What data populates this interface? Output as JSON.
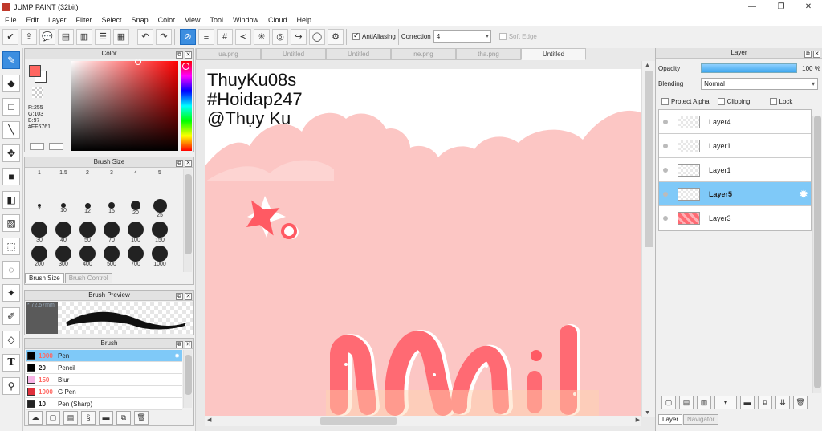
{
  "window": {
    "title": "JUMP PAINT (32bit)",
    "minimize": "—",
    "restore": "❐",
    "close": "✕"
  },
  "menu": [
    "File",
    "Edit",
    "Layer",
    "Filter",
    "Select",
    "Snap",
    "Color",
    "View",
    "Tool",
    "Window",
    "Cloud",
    "Help"
  ],
  "toolbar": {
    "antialiasing_label": "AntiAliasing",
    "antialiasing_checked": true,
    "correction_label": "Correction",
    "correction_value": "4",
    "soft_edge_label": "Soft Edge",
    "soft_edge_checked": false
  },
  "color_panel": {
    "title": "Color",
    "foreground": "#FF6761",
    "rgb": {
      "r": "R:255",
      "g": "G:103",
      "b": "B:97",
      "hex": "#FF6761"
    }
  },
  "brush_size_panel": {
    "title": "Brush Size",
    "sizes": [
      "1",
      "1.5",
      "2",
      "3",
      "4",
      "5",
      "7",
      "10",
      "12",
      "15",
      "20",
      "25",
      "30",
      "40",
      "50",
      "70",
      "100",
      "150",
      "200",
      "300",
      "400",
      "500",
      "700",
      "1000"
    ],
    "tabs": [
      "Brush Size",
      "Brush Control"
    ]
  },
  "brush_preview_panel": {
    "title": "Brush Preview",
    "size_text": "* 72.57mm"
  },
  "brush_panel": {
    "title": "Brush",
    "brushes": [
      {
        "size": "1000",
        "name": "Pen",
        "color": "#000000",
        "selected": true
      },
      {
        "size": "20",
        "name": "Pencil",
        "color": "#000000",
        "selected": false
      },
      {
        "size": "150",
        "name": "Blur",
        "color": "#f7b3e5",
        "selected": false
      },
      {
        "size": "1000",
        "name": "G Pen",
        "color": "#e0303c",
        "selected": false
      },
      {
        "size": "10",
        "name": "Pen (Sharp)",
        "color": "#222222",
        "selected": false
      }
    ]
  },
  "document_tabs": [
    "ua.png",
    "Untitled",
    "Untitled",
    "ne.png",
    "tha.png",
    "Untitled"
  ],
  "active_tab_index": 5,
  "canvas": {
    "text_lines": [
      "ThuyKu08s",
      "#Hoidap247",
      "@Thụy Ku"
    ],
    "bg_color": "#fcc6c4",
    "letter_color": "#ff6a73"
  },
  "layer_panel": {
    "title": "Layer",
    "opacity_label": "Opacity",
    "opacity_value": "100 %",
    "opacity_fraction": 1.0,
    "blending_label": "Blending",
    "blending_value": "Normal",
    "protect_alpha": "Protect Alpha",
    "clipping": "Clipping",
    "lock": "Lock",
    "layers": [
      {
        "name": "Layer4",
        "selected": false
      },
      {
        "name": "Layer1",
        "selected": false
      },
      {
        "name": "Layer1",
        "selected": false
      },
      {
        "name": "Layer5",
        "selected": true
      },
      {
        "name": "Layer3",
        "selected": false
      }
    ],
    "tabs": [
      "Layer",
      "Navigator"
    ]
  }
}
